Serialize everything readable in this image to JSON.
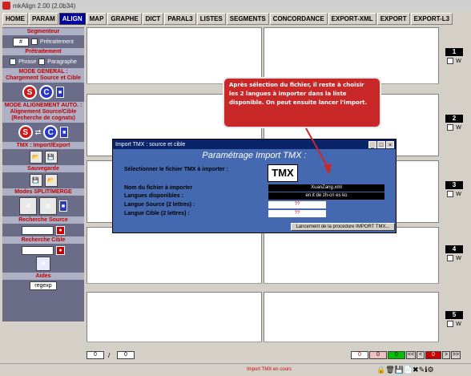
{
  "window": {
    "title": "mkAlign 2.00 (2.0b34)"
  },
  "tabs": [
    {
      "label": "HOME"
    },
    {
      "label": "PARAM"
    },
    {
      "label": "ALIGN",
      "active": true
    },
    {
      "label": "MAP"
    },
    {
      "label": "GRAPHE"
    },
    {
      "label": "DICT"
    },
    {
      "label": "PARAL3"
    },
    {
      "label": "LISTES"
    },
    {
      "label": "SEGMENTS"
    },
    {
      "label": "CONCORDANCE"
    },
    {
      "label": "EXPORT-XML"
    },
    {
      "label": "EXPORT"
    },
    {
      "label": "EXPORT-L3"
    }
  ],
  "sidebar": {
    "segmenteur": "Segmenteur",
    "segmenteur_value": "#",
    "pretraitement_label": "Prétraitement",
    "pretraitement_head": "Prétraitement",
    "phrase": "Phrase",
    "paragraphe": "Paragraphe",
    "mode_general": "MODE GENERAL :",
    "mode_general_sub": "Chargement Source et Cible",
    "mode_auto": "MODE ALIGNEMENT AUTO. :",
    "mode_auto_sub": "Alignement Source/Cible",
    "mode_auto_sub2": "(Recherche de cognats)",
    "s_label": "S",
    "c_label": "C",
    "tmx_head": "TMX : Import/Export",
    "sauvegarde": "Sauvegarde",
    "split_merge": "Modes SPLIT/MERGE",
    "recherche_source": "Recherche Source",
    "recherche_cible": "Recherche Cible",
    "aides": "Aides",
    "regexp": "regexp"
  },
  "panes": {
    "numbers": [
      "1",
      "2",
      "3",
      "4",
      "5"
    ],
    "w_label": "W"
  },
  "dialog": {
    "title": "Import TMX : source et cible",
    "heading": "Paramétrage Import TMX :",
    "select_label": "Sélectionner le fichier TMX à importer :",
    "tmx_icon_text": "TMX",
    "filename_label": "Nom du fichier à importer",
    "filename_value": "XuanZang.xml",
    "langs_label": "Langues disponibles :",
    "langs_value": "en it de zh-cn es ko",
    "src_label": "Langue Source (2 lettres) :",
    "src_value": "??",
    "tgt_label": "Langue Cible (2 lettres) :",
    "tgt_value": "??",
    "launch": "Lancement de la procédure IMPORT TMX..."
  },
  "callout": {
    "text": "Après sélection du fichier, il reste à choisir les 2 langues à importer dans la liste disponible. On peut ensuite lancer l'import."
  },
  "statusbar": {
    "left_value": "0",
    "left_sep": "/",
    "left_total": "0",
    "counts": [
      "0",
      "0",
      "0"
    ],
    "nav_first": "<<",
    "nav_prev": "<",
    "nav_value": "0",
    "nav_next": ">",
    "nav_last": ">>"
  },
  "footer": {
    "status_text": "Import TMX en cours"
  },
  "colors": {
    "accent": "#0000a0",
    "sidebar": "#6a6c88",
    "callout": "#c92828",
    "dialog": "#4569b0"
  }
}
